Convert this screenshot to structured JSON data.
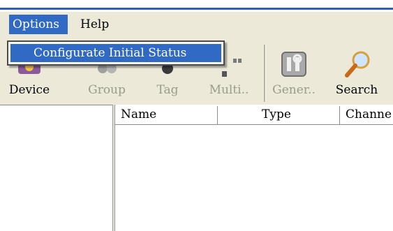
{
  "menubar": {
    "options": "Options",
    "help": "Help"
  },
  "dropdown": {
    "item": "Configurate Initial Status"
  },
  "toolbar": {
    "device": "Device",
    "group": "Group",
    "tag": "Tag",
    "multi": "Multi..",
    "general": "Gener..",
    "search": "Search"
  },
  "list": {
    "columns": [
      "Name",
      "Type",
      "Channe"
    ]
  }
}
